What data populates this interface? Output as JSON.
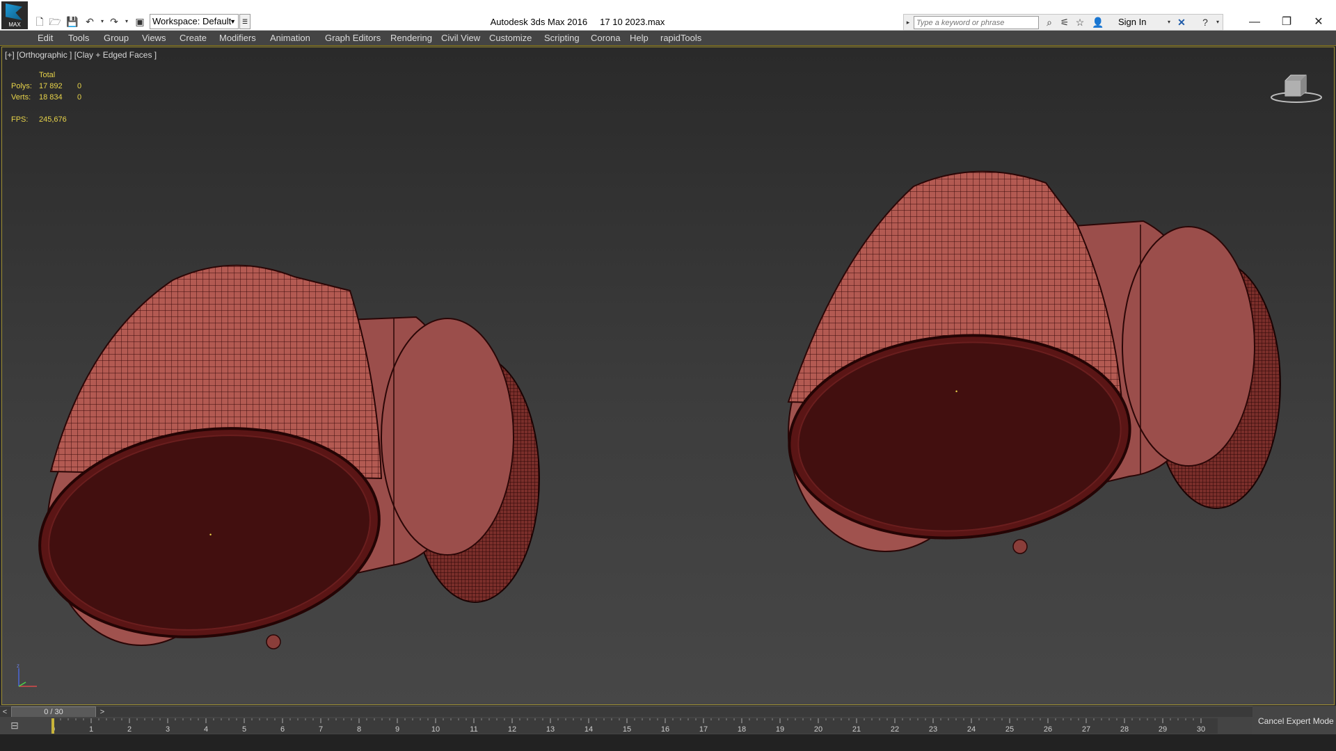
{
  "app": {
    "title": "Autodesk 3ds Max 2016     17 10 2023.max",
    "logo_text": "MAX"
  },
  "quick_access": {
    "workspace_label": "Workspace: Default",
    "icons": [
      "new-file-icon",
      "open-file-icon",
      "save-icon",
      "undo-icon",
      "redo-icon",
      "project-icon"
    ]
  },
  "infocenter": {
    "search_placeholder": "Type a keyword or phrase",
    "sign_in": "Sign In"
  },
  "menu": {
    "items": [
      "Edit",
      "Tools",
      "Group",
      "Views",
      "Create",
      "Modifiers",
      "Animation",
      "Graph Editors",
      "Rendering",
      "Civil View",
      "Customize",
      "Scripting",
      "Corona",
      "Help",
      "rapidTools"
    ]
  },
  "viewport": {
    "label": "[+] [Orthographic ] [Clay + Edged Faces ]",
    "stats": {
      "header": "Total",
      "polys_label": "Polys:",
      "polys_total": "17 892",
      "polys_sel": "0",
      "verts_label": "Verts:",
      "verts_total": "18 834",
      "verts_sel": "0",
      "fps_label": "FPS:",
      "fps_value": "245,676"
    },
    "colors": {
      "clay": "#9b4e4b",
      "dark": "#420f0f",
      "edge": "#2a0606"
    }
  },
  "timeline": {
    "frame": "0 / 30",
    "prev": "<",
    "next": ">",
    "ticks": [
      "0",
      "1",
      "2",
      "3",
      "4",
      "5",
      "6",
      "7",
      "8",
      "9",
      "10",
      "11",
      "12",
      "13",
      "14",
      "15",
      "16",
      "17",
      "18",
      "19",
      "20",
      "21",
      "22",
      "23",
      "24",
      "25",
      "26",
      "27",
      "28",
      "29",
      "30"
    ]
  },
  "status": {
    "cancel_expert": "Cancel Expert Mode"
  }
}
